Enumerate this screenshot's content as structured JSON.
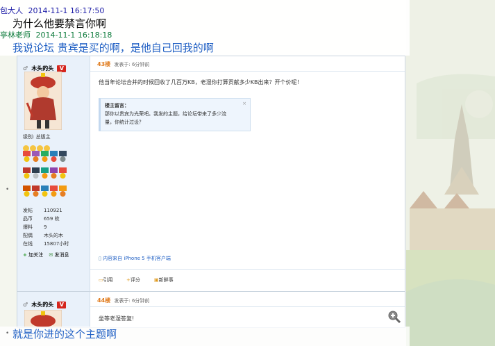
{
  "messages": [
    {
      "sender": "包大人",
      "time": "2014-11-1 16:17:50",
      "text": "为什么他要禁言你啊",
      "sender_color": "#1a1aa6",
      "text_color": "#000000"
    },
    {
      "sender": "亭林老师",
      "time": "2014-11-1 16:18:18",
      "text": "我说论坛 贵宾是买的啊，是他自己回我的啊",
      "sender_color": "#0b7a3a",
      "text_color": "#1f5fc4"
    },
    {
      "text": "就是你进的这个主题啊",
      "text_color": "#1f5fc4"
    }
  ],
  "forum": {
    "post1": {
      "username": "木头的头",
      "vip_badge": "V",
      "group_label": "级别: 总版主",
      "stats": [
        {
          "label": "发帖",
          "value": "110921"
        },
        {
          "label": "品币",
          "value": "659 枚"
        },
        {
          "label": "爆料",
          "value": "9"
        },
        {
          "label": "配偶",
          "value": "木头的木"
        },
        {
          "label": "在线",
          "value": "15807小时"
        }
      ],
      "follow_label": "加关注",
      "message_label": "发消息",
      "floor": "43楼",
      "posted": "发表于: 6分钟前",
      "body": "他当年论坛合并的时候回收了几百万KB，老湿你打算贡献多少KB出来？开个价呢！",
      "moderator_title": "楼主留言：",
      "moderator_close": "×",
      "moderator_text_1": "那你以贵宾为光荣吧。我发的主题，给论坛带来了多少流",
      "moderator_text_2": "量，你统计过设？",
      "client_text": "内容来自 iPhone 5 手机客户端",
      "actions": [
        "引用",
        "评分",
        "新鲜事"
      ]
    },
    "post2": {
      "username": "木头的头",
      "vip_badge": "V",
      "floor": "44楼",
      "posted": "发表于: 6分钟前",
      "body": "坐等老湿答复!"
    }
  },
  "colors": {
    "accent_orange": "#e07b1d",
    "vip_red": "#d5251d",
    "link_blue": "#1f5fc4"
  }
}
